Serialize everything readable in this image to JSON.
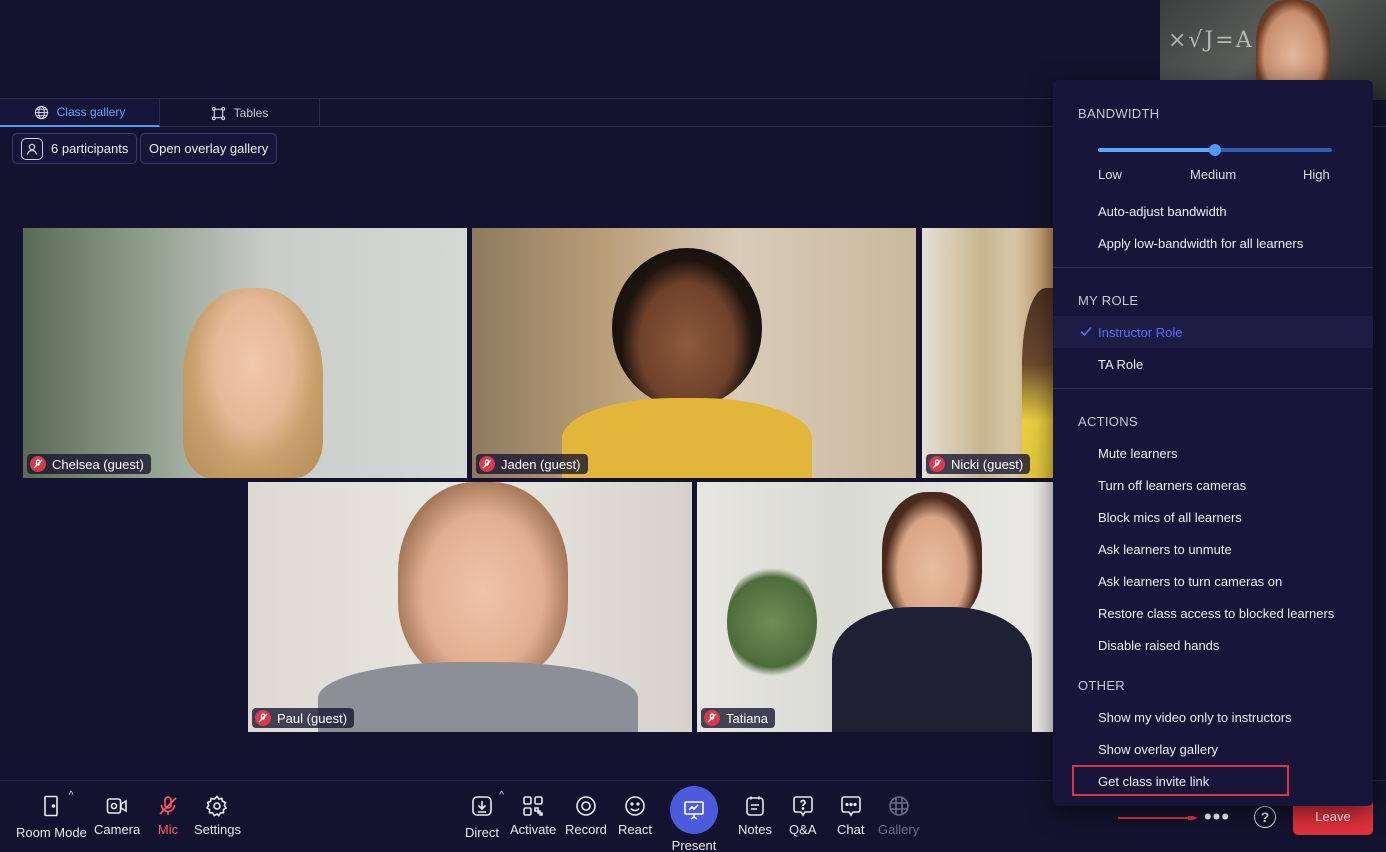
{
  "tabs": [
    {
      "label": "Class gallery",
      "icon": "globe-icon",
      "active": true
    },
    {
      "label": "Tables",
      "icon": "table-layout-icon",
      "active": false
    }
  ],
  "gallery_toolbar": {
    "participants_label": "6 participants",
    "overlay_button_label": "Open overlay gallery"
  },
  "participants": [
    {
      "name": "Chelsea (guest)",
      "muted": true
    },
    {
      "name": "Jaden (guest)",
      "muted": true
    },
    {
      "name": "Nicki (guest)",
      "muted": true
    },
    {
      "name": "Paul (guest)",
      "muted": true
    },
    {
      "name": "Tatiana",
      "muted": true
    }
  ],
  "self_video": {
    "board_text": "×√J=A ∫"
  },
  "menu": {
    "bandwidth": {
      "title": "BANDWIDTH",
      "slider_level": 0.5,
      "levels": [
        "Low",
        "Medium",
        "High"
      ],
      "items": [
        "Auto-adjust bandwidth",
        "Apply low-bandwidth for all learners"
      ]
    },
    "role": {
      "title": "MY ROLE",
      "items": [
        {
          "label": "Instructor Role",
          "checked": true
        },
        {
          "label": "TA Role",
          "checked": false
        }
      ]
    },
    "actions": {
      "title": "ACTIONS",
      "items": [
        "Mute learners",
        "Turn off learners cameras",
        "Block mics of all learners",
        "Ask learners to unmute",
        "Ask learners to turn cameras on",
        "Restore class access to blocked learners",
        "Disable raised hands"
      ]
    },
    "other": {
      "title": "OTHER",
      "items": [
        "Show my video only to instructors",
        "Show overlay gallery",
        "Get class invite link"
      ]
    }
  },
  "toolbar": {
    "left": [
      {
        "label": "Room Mode",
        "icon": "door-icon"
      },
      {
        "label": "Camera",
        "icon": "camera-icon"
      },
      {
        "label": "Mic",
        "icon": "mic-off-icon"
      },
      {
        "label": "Settings",
        "icon": "gear-icon"
      }
    ],
    "center": [
      {
        "label": "Direct",
        "icon": "download-icon"
      },
      {
        "label": "Activate",
        "icon": "qr-icon"
      },
      {
        "label": "Record",
        "icon": "record-icon"
      },
      {
        "label": "React",
        "icon": "smile-icon"
      },
      {
        "label": "Present",
        "icon": "present-icon"
      },
      {
        "label": "Notes",
        "icon": "notes-icon"
      },
      {
        "label": "Q&A",
        "icon": "qa-icon"
      },
      {
        "label": "Chat",
        "icon": "chat-icon"
      },
      {
        "label": "Gallery",
        "icon": "grid-icon"
      }
    ],
    "more_label": "•••",
    "help_label": "?",
    "leave_label": "Leave"
  },
  "colors": {
    "background": "#14132f",
    "accent": "#4b9cff",
    "present": "#4b5bdb",
    "leave": "#e0313c",
    "mic_off": "#ff5a63"
  }
}
